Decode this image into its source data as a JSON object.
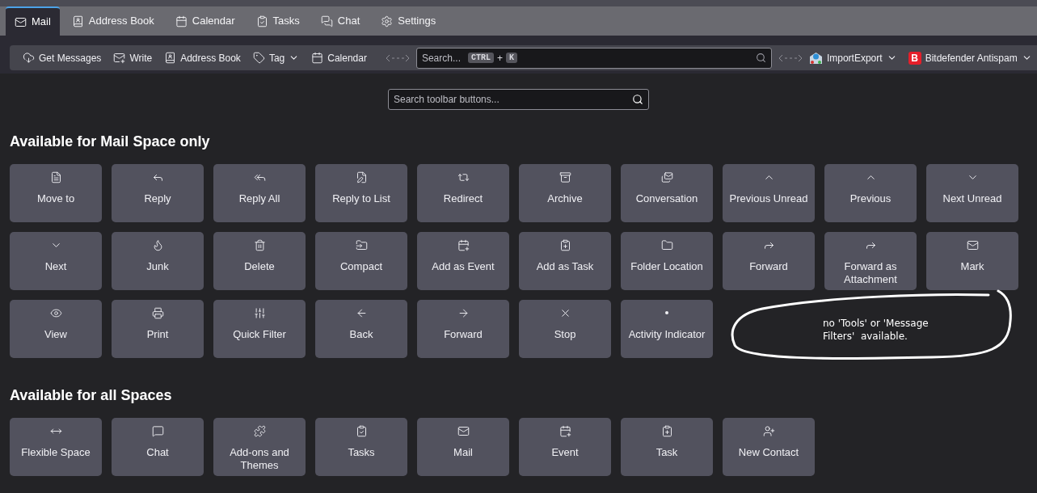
{
  "tabs": [
    {
      "label": "Mail",
      "selected": true
    },
    {
      "label": "Address Book",
      "selected": false
    },
    {
      "label": "Calendar",
      "selected": false
    },
    {
      "label": "Tasks",
      "selected": false
    },
    {
      "label": "Chat",
      "selected": false
    },
    {
      "label": "Settings",
      "selected": false
    }
  ],
  "toolbar": {
    "left_items": [
      {
        "label": "Get Messages",
        "dropdown": false
      },
      {
        "label": "Write",
        "dropdown": false
      },
      {
        "label": "Address Book",
        "dropdown": false
      },
      {
        "label": "Tag",
        "dropdown": true
      },
      {
        "label": "Calendar",
        "dropdown": false
      }
    ],
    "search": {
      "placeholder": "Search...",
      "shortcut_keys": [
        "CTRL",
        "K"
      ],
      "shortcut_joiner": "+"
    },
    "right_items": [
      {
        "label": "ImportExport",
        "dropdown": true,
        "kind": "importexport"
      },
      {
        "label": "Bitdefender Antispam",
        "dropdown": true,
        "kind": "bitdefender",
        "logo_letter": "B"
      }
    ]
  },
  "button_search": {
    "placeholder": "Search toolbar buttons..."
  },
  "sections": [
    {
      "title": "Available for Mail Space only",
      "buttons": [
        "Move to",
        "Reply",
        "Reply All",
        "Reply to List",
        "Redirect",
        "Archive",
        "Conversation",
        "Previous Unread",
        "Previous",
        "Next Unread",
        "Next",
        "Junk",
        "Delete",
        "Compact",
        "Add as Event",
        "Add as Task",
        "Folder Location",
        "Forward",
        "Forward as Attachment",
        "Mark",
        "View",
        "Print",
        "Quick Filter",
        "Back",
        "Forward",
        "Stop",
        "Activity Indicator"
      ]
    },
    {
      "title": "Available for all Spaces",
      "buttons": [
        "Flexible Space",
        "Chat",
        "Add-ons and Themes",
        "Tasks",
        "Mail",
        "Event",
        "Task",
        "New Contact"
      ]
    }
  ],
  "annotation": {
    "text": "no 'Tools' or 'Message Filters'  available."
  }
}
